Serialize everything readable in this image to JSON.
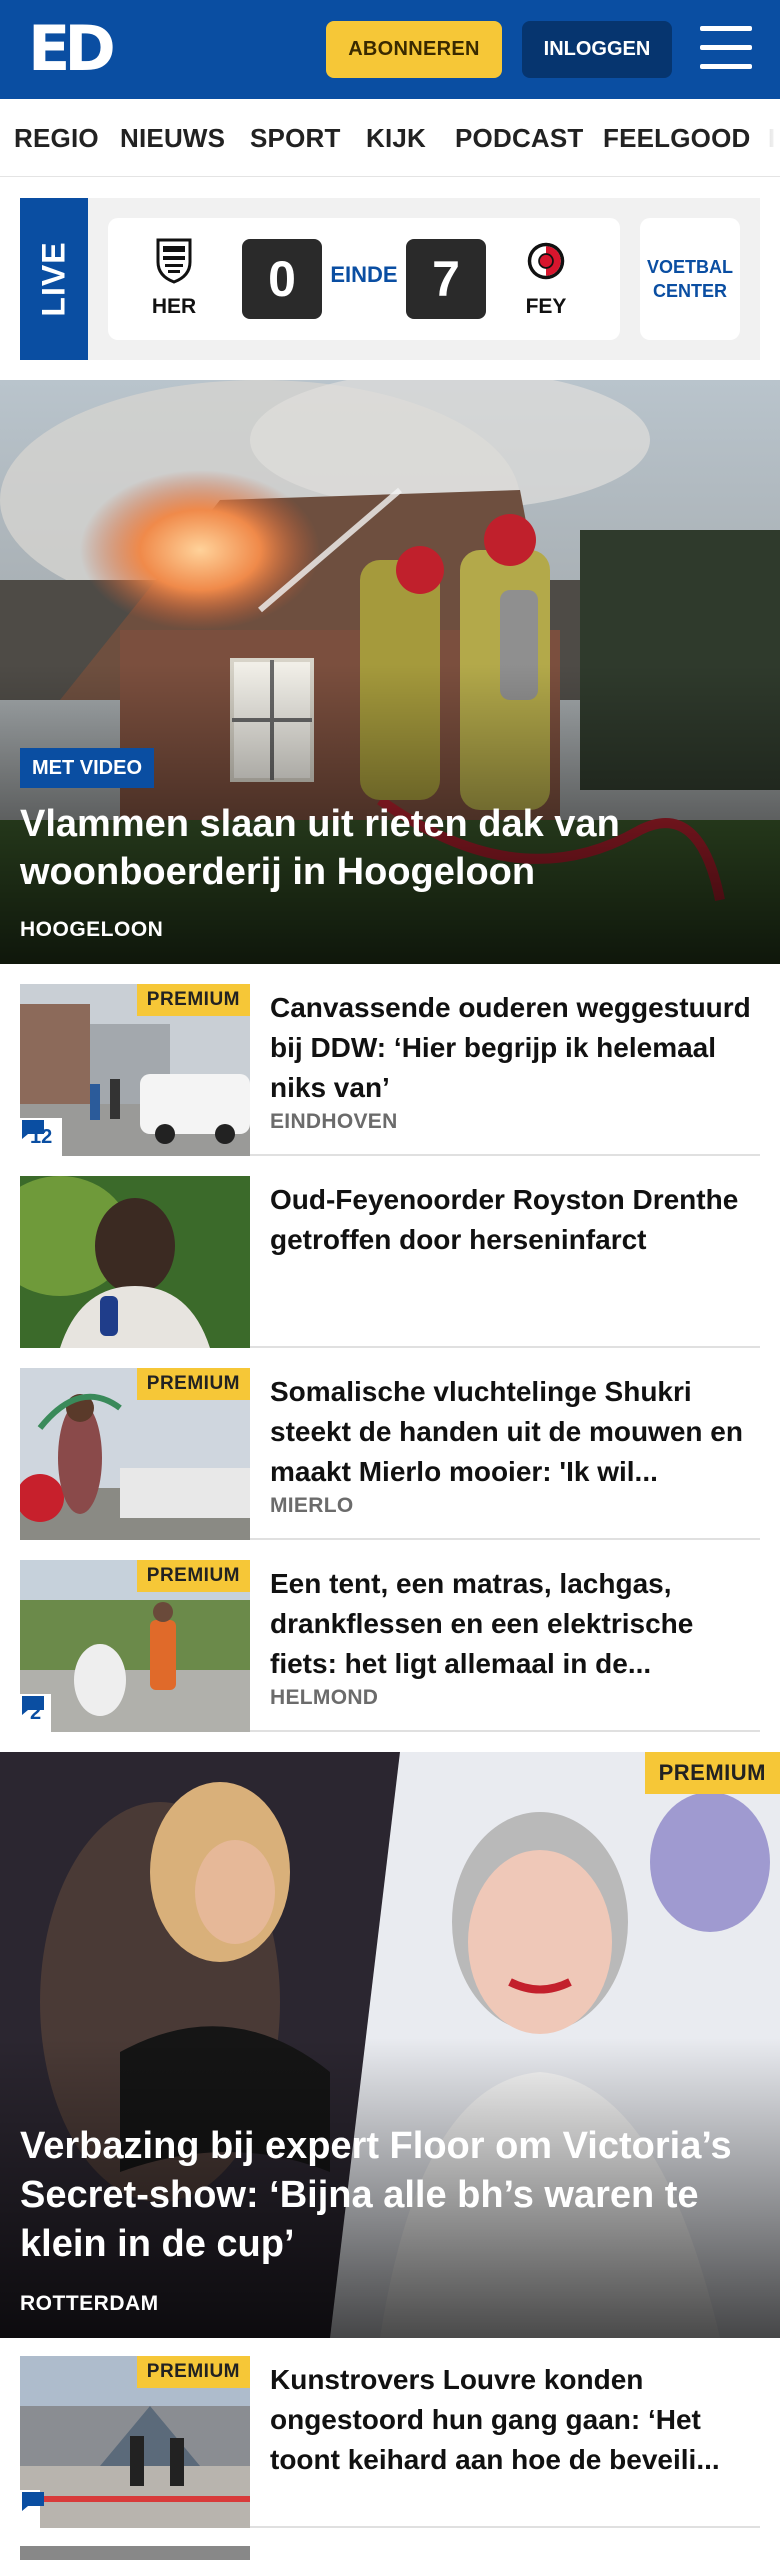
{
  "header": {
    "logo_text": "ED",
    "subscribe_label": "ABONNEREN",
    "login_label": "INLOGGEN",
    "brand_color": "#0a4ea2",
    "accent_color": "#f6c737",
    "menu_icon": "hamburger-menu-icon"
  },
  "nav": {
    "items": [
      "REGIO",
      "NIEUWS",
      "SPORT",
      "KIJK",
      "PODCAST",
      "FEELGOOD"
    ]
  },
  "live": {
    "tag": "LIVE",
    "home_team": "HER",
    "home_score": "0",
    "status": "EINDE",
    "away_team": "FEY",
    "away_score": "7",
    "center_label": "VOETBAL CENTER"
  },
  "hero": {
    "badge": "MET VIDEO",
    "title": "Vlammen slaan uit rieten dak van woonboerderij in Hoogeloon",
    "location": "HOOGELOON"
  },
  "articles": [
    {
      "premium": "PREMIUM",
      "comments": "12",
      "title": "Canvassende ouderen wegge­stuurd bij DDW: ‘Hier begrijp ik helemaal niks van’",
      "location": "EINDHOVEN"
    },
    {
      "title": "Oud-Feyenoorder Royston Drenthe getroffen door hersenin­farct"
    },
    {
      "premium": "PREMIUM",
      "title": "Somalische vluchtelinge Shukri steekt de handen uit de mouwen en maakt Mierlo mooier: 'Ik wil...",
      "location": "MIERLO"
    },
    {
      "premium": "PREMIUM",
      "comments": "2",
      "title": "Een tent, een matras, lachgas, drankflessen en een elektrische fiets: het ligt allemaal in de...",
      "location": "HELMOND"
    }
  ],
  "feature": {
    "premium": "PREMIUM",
    "title": "Verbazing bij expert Floor om Victoria’s Secret-show: ‘Bijna alle bh’s waren te klein in de cup’",
    "location": "ROTTERDAM"
  },
  "article_last": {
    "premium": "PREMIUM",
    "title": "Kunstrovers Louvre konden ongestoord hun gang gaan: ‘Het toont keihard aan hoe de beveili..."
  }
}
